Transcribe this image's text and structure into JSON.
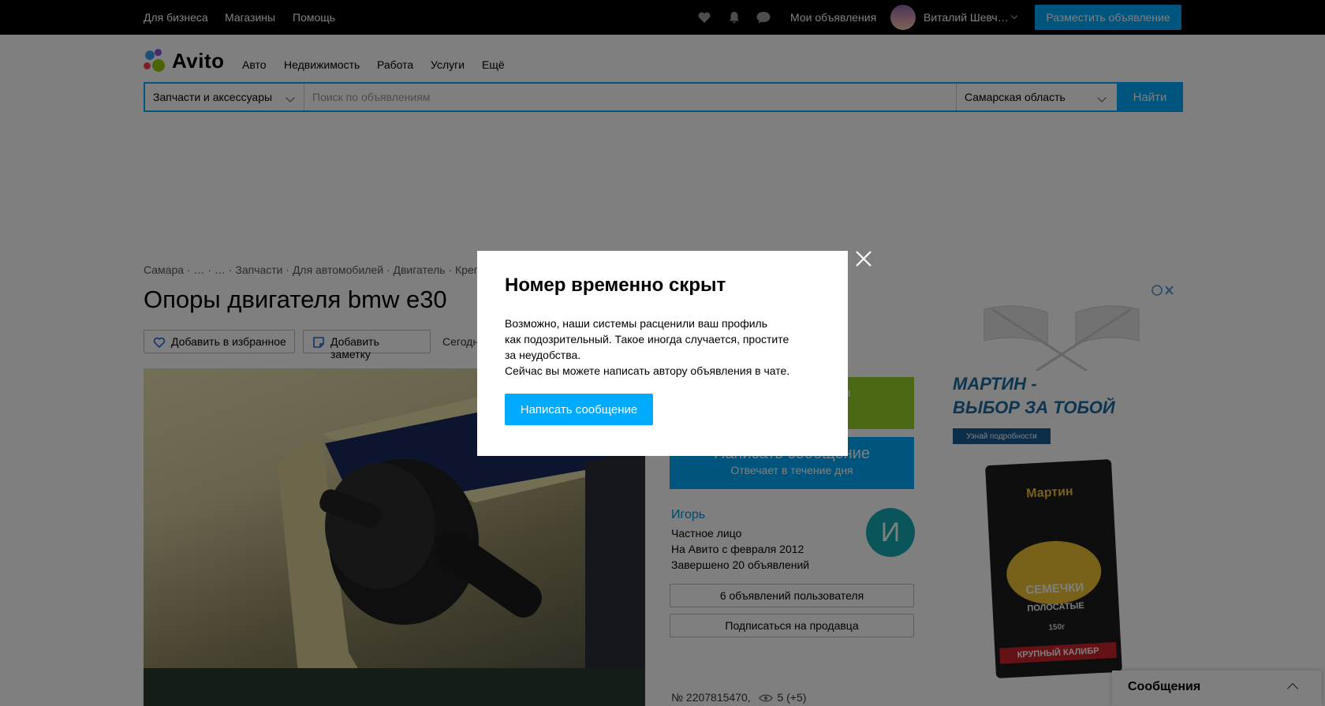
{
  "topbar": {
    "links": [
      "Для бизнеса",
      "Магазины",
      "Помощь"
    ],
    "my_ads": "Мои объявления",
    "user_name": "Виталий Шевч…",
    "place_ad": "Разместить объявление"
  },
  "header": {
    "logo_text": "Avito",
    "nav": [
      "Авто",
      "Недвижимость",
      "Работа",
      "Услуги",
      "Ещё"
    ]
  },
  "search": {
    "category": "Запчасти и аксессуары",
    "placeholder": "Поиск по объявлениям",
    "region": "Самарская область",
    "find_label": "Найти"
  },
  "listing": {
    "breadcrumb": "Самара · … · … · Запчасти · Для автомобилей · Двигатель · Креп",
    "title": "Опоры двигателя bmw e30",
    "add_favorite": "Добавить в избранное",
    "add_note": "Добавить заметку",
    "date_prefix": "Сегодн",
    "green_btn_text": "он",
    "write_message": "Написать сообщение",
    "reply_time": "Отвечает в течение дня",
    "seller": {
      "name": "Игорь",
      "type": "Частное лицо",
      "since": "На Авито с февраля 2012",
      "completed": "Завершено 20 объявлений",
      "avatar_letter": "И"
    },
    "user_ads": "6 объявлений пользователя",
    "subscribe": "Подписаться на продавца",
    "item_number": "№ 2207815470,",
    "views": "5 (+5)"
  },
  "ad": {
    "headline_1": "МАРТИН -",
    "headline_2": "ВЫБОР ЗА ТОБОЙ",
    "cta": "Узнай подробности",
    "pack_brand": "Мартин",
    "pack_product": "СЕМЕЧКИ",
    "pack_sub": "ПОЛОСАТЫЕ",
    "pack_bottom": "КРУПНЫЙ КАЛИБР",
    "pack_weight": "150г"
  },
  "messages_widget": {
    "title": "Сообщения"
  },
  "modal": {
    "title": "Номер временно скрыт",
    "body_line1": "Возможно, наши системы расценили ваш профиль",
    "body_line2": "как подозрительный. Такое иногда случается, простите",
    "body_line3": "за неудобства.",
    "body_line4": "Сейчас вы можете написать автору объявления в чате.",
    "button": "Написать сообщение"
  },
  "colors": {
    "accent": "#00aaff",
    "green": "#97cf26",
    "overlay": "rgba(0,0,0,0.5)",
    "seller_avatar": "#14aab2"
  }
}
